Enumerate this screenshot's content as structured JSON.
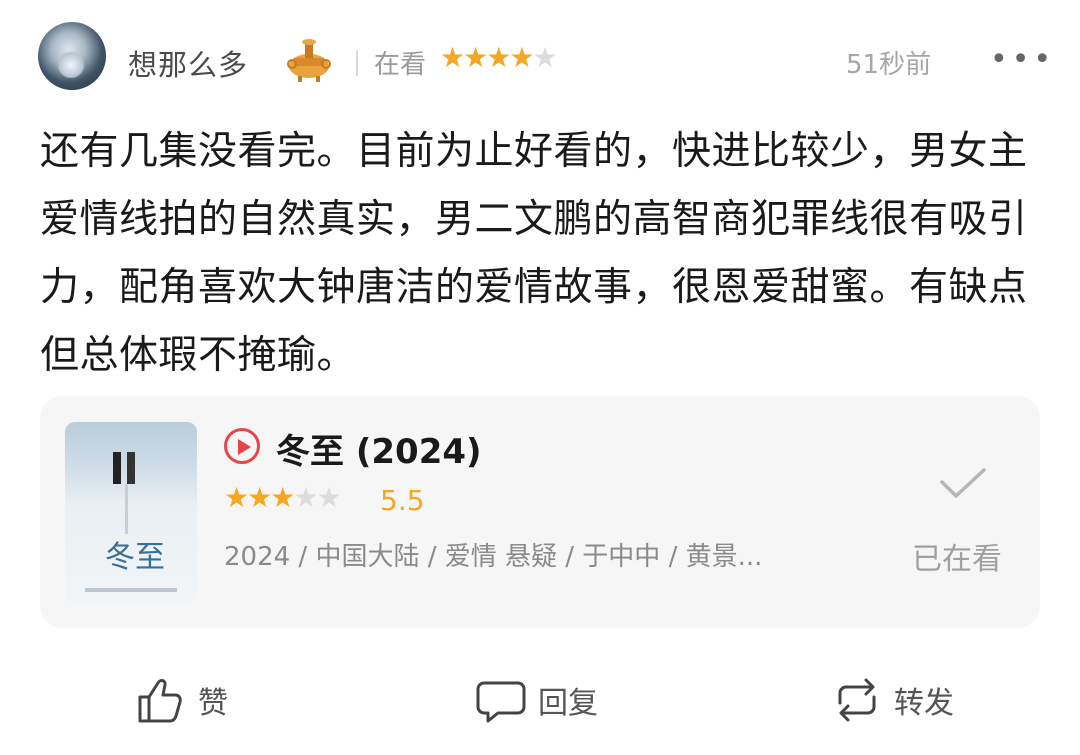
{
  "post": {
    "username": "想那么多",
    "badge_icon": "hotpot-badge-icon",
    "status": "在看",
    "user_rating": 4,
    "user_rating_stars": "★★★★★",
    "time": "51秒前",
    "more": "•••",
    "review_text": "还有几集没看完。目前为止好看的，快进比较少，男女主爱情线拍的自然真实，男二文鹏的高智商犯罪线很有吸引力，配角喜欢大钟唐洁的爱情故事，很恩爱甜蜜。有缺点但总体瑕不掩瑜。"
  },
  "card": {
    "title": "冬至 (2024)",
    "rating": 5.5,
    "rating_text": "5.5",
    "rating_stars": "★★★★★",
    "meta": "2024 / 中国大陆 / 爱情 悬疑 / 于中中 / 黄景...",
    "watched_label": "已在看",
    "poster_logo": "冬至"
  },
  "actions": {
    "like": "赞",
    "reply": "回复",
    "repost": "转发"
  },
  "colors": {
    "star": "#f5a623",
    "star_empty": "#dcdcdc",
    "play_accent": "#e8454a",
    "card_bg": "#f6f6f6"
  }
}
